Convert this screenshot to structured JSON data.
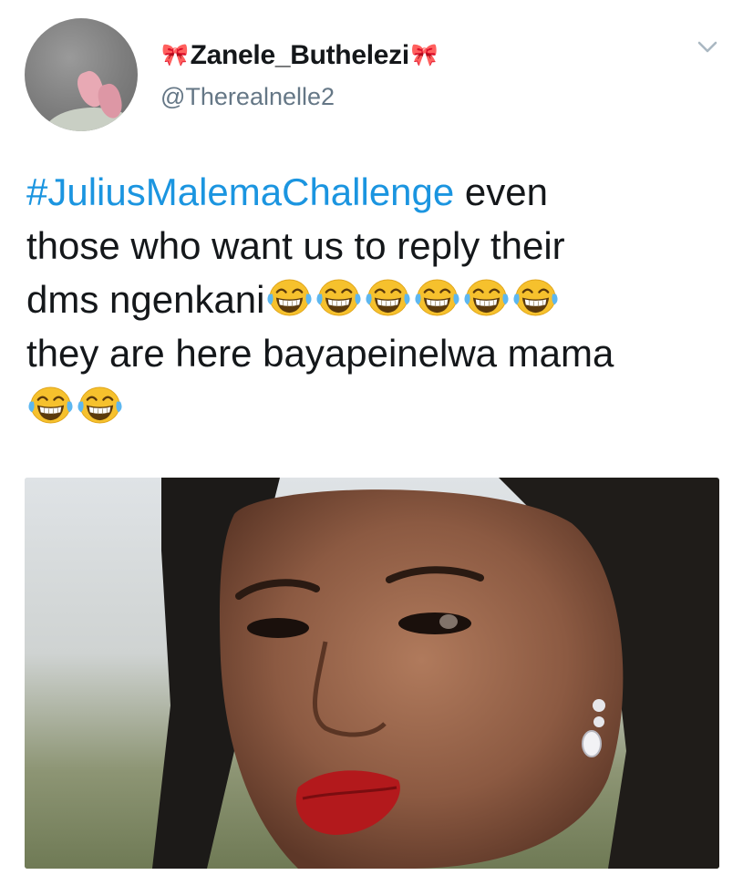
{
  "user": {
    "display_name": "Zanele_Buthelezi",
    "name_decoration_icon": "ribbon-bow-icon",
    "handle": "@Therealnelle2",
    "avatar": "profile-photo-pink-sneakers"
  },
  "menu": {
    "icon": "chevron-down-icon"
  },
  "tweet": {
    "hashtag": "#JuliusMalemaChallenge",
    "line1_rest": " even",
    "line2": "those who want us to reply their",
    "line3": "dms ngenkani",
    "line3_emoji_count": 6,
    "line4": "they are here bayapeinelwa mama",
    "line5_emoji_count": 2,
    "emoji": "face-with-tears-of-joy"
  },
  "media": {
    "image": "photo-woman-side-eye-braids"
  },
  "colors": {
    "hashtag": "#1b95e0",
    "text": "#14171a",
    "secondary": "#657786",
    "emoji_yellow": "#f6c12d"
  }
}
